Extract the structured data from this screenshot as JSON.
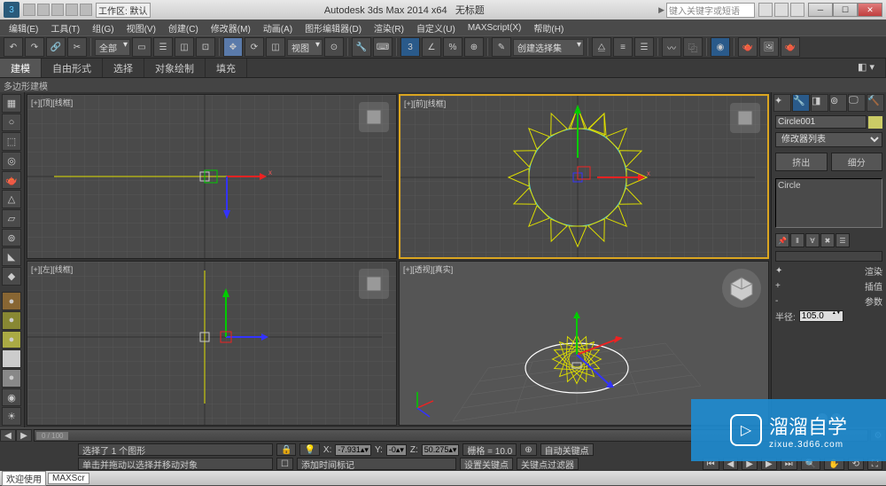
{
  "titlebar": {
    "app_title": "Autodesk 3ds Max  2014 x64",
    "doc_title": "无标题",
    "workspace_label": "工作区: 默认",
    "search_placeholder": "键入关键字或短语"
  },
  "menu": {
    "items": [
      "编辑(E)",
      "工具(T)",
      "组(G)",
      "视图(V)",
      "创建(C)",
      "修改器(M)",
      "动画(A)",
      "图形编辑器(D)",
      "渲染(R)",
      "自定义(U)",
      "MAXScript(X)",
      "帮助(H)"
    ]
  },
  "toolbar1": {
    "all_label": "全部",
    "view_label": "视图",
    "angle_label": "3",
    "selset_label": "创建选择集"
  },
  "ribbon": {
    "tabs": [
      "建模",
      "自由形式",
      "选择",
      "对象绘制",
      "填充"
    ],
    "subheader": "多边形建模"
  },
  "viewports": {
    "top": "[+][顶][线框]",
    "front": "[+][前][线框]",
    "left": "[+][左][线框]",
    "persp": "[+][透视][真实]"
  },
  "command_panel": {
    "object_name": "Circle001",
    "modlist_label": "修改器列表",
    "extrude_btn": "挤出",
    "subdiv_btn": "细分",
    "stack_item": "Circle",
    "param_rows": [
      {
        "icon": "✦",
        "label": "渲染"
      },
      {
        "icon": "+",
        "label": "插值"
      },
      {
        "icon": "-",
        "label": "参数"
      }
    ],
    "radius_label": "半径:",
    "radius_value": "105.0"
  },
  "timeline": {
    "start": "0",
    "range": "0 / 100"
  },
  "status": {
    "selection_info": "选择了 1 个图形",
    "hint": "单击并拖动以选择并移动对象",
    "x_label": "X:",
    "x_val": "-7.931",
    "y_label": "Y:",
    "y_val": "-0",
    "z_label": "Z:",
    "z_val": "50.275",
    "grid_label": "栅格 = 10.0",
    "autokey": "自动关键点",
    "setkey": "设置关键点",
    "addtime": "添加时间标记",
    "filters": "关键点过滤器"
  },
  "bottombar": {
    "welcome": "欢迎使用",
    "maxscr": "MAXScr"
  },
  "watermark": {
    "brand": "溜溜自学",
    "url": "zixue.3d66.com"
  }
}
